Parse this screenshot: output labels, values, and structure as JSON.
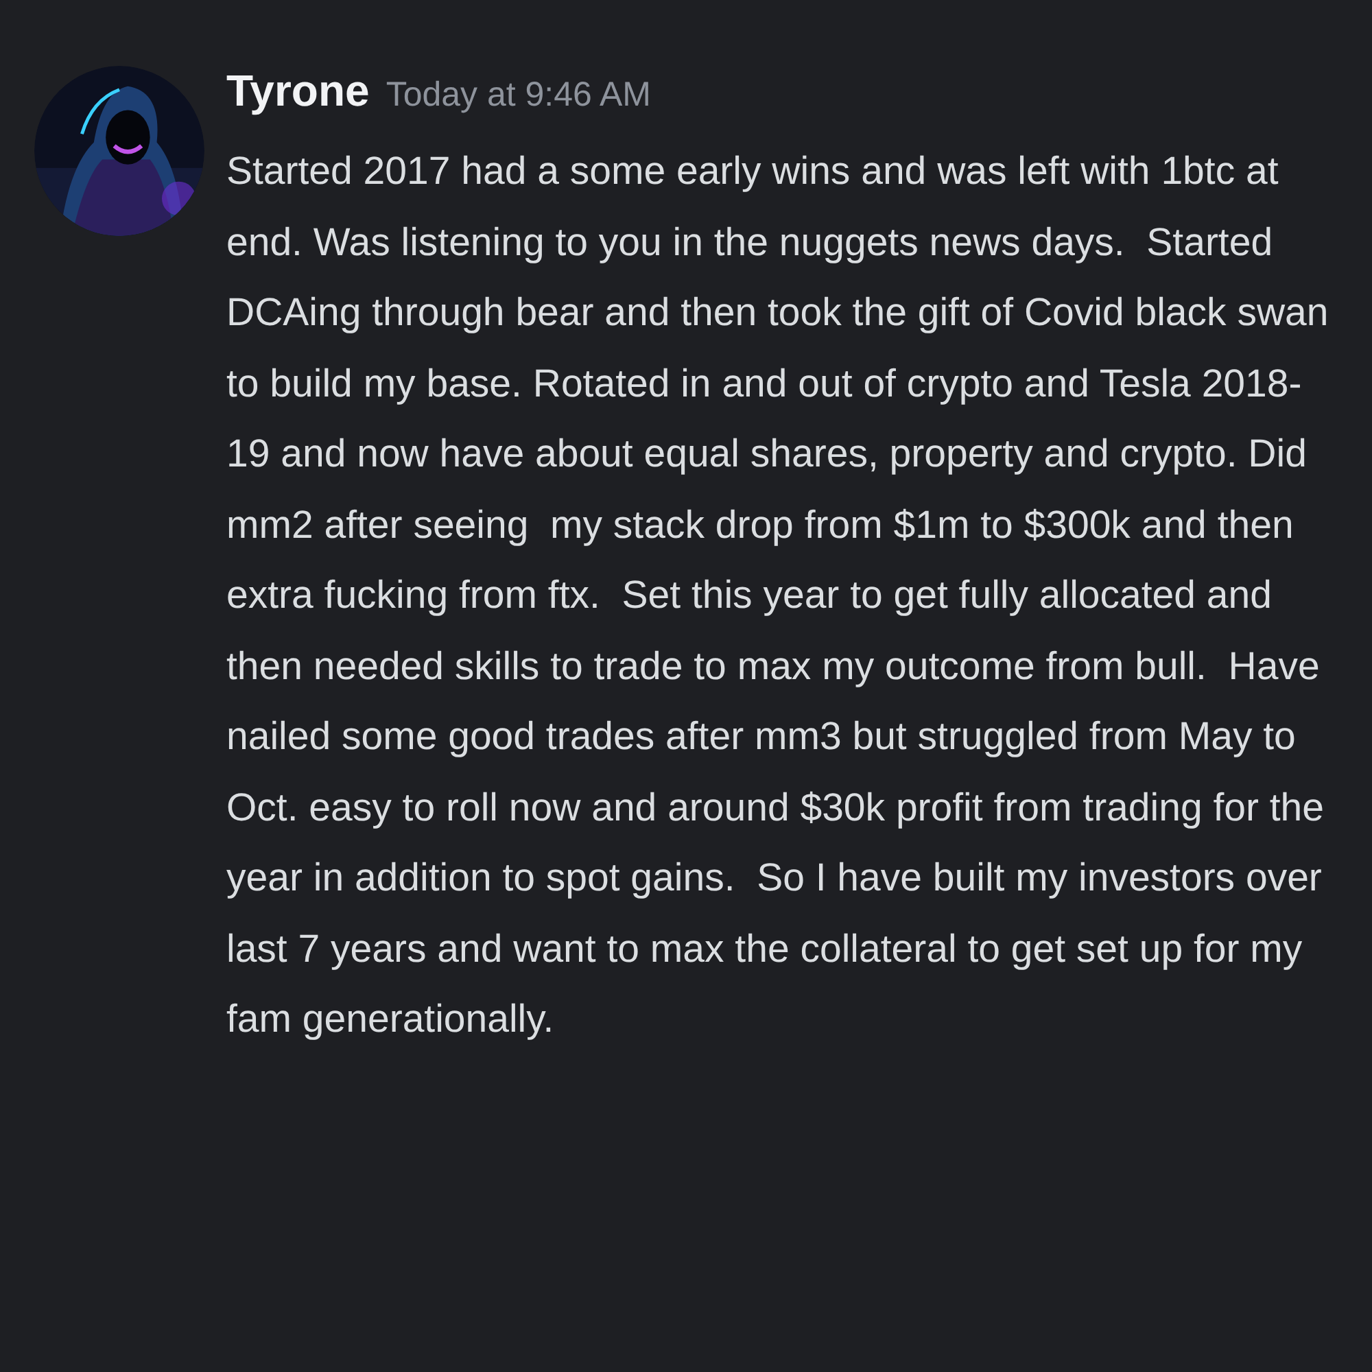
{
  "message": {
    "author": "Tyrone",
    "timestamp": "Today at 9:46 AM",
    "text": "Started 2017 had a some early wins and was left with 1btc at end. Was listening to you in the nuggets news days.  Started DCAing through bear and then took the gift of Covid black swan to build my base. Rotated in and out of crypto and Tesla 2018-19 and now have about equal shares, property and crypto. Did mm2 after seeing  my stack drop from $1m to $300k and then extra fucking from ftx.  Set this year to get fully allocated and then needed skills to trade to max my outcome from bull.  Have nailed some good trades after mm3 but struggled from May to Oct. easy to roll now and around $30k profit from trading for the year in addition to spot gains.  So I have built my investors over last 7 years and want to max the collateral to get set up for my fam generationally."
  }
}
